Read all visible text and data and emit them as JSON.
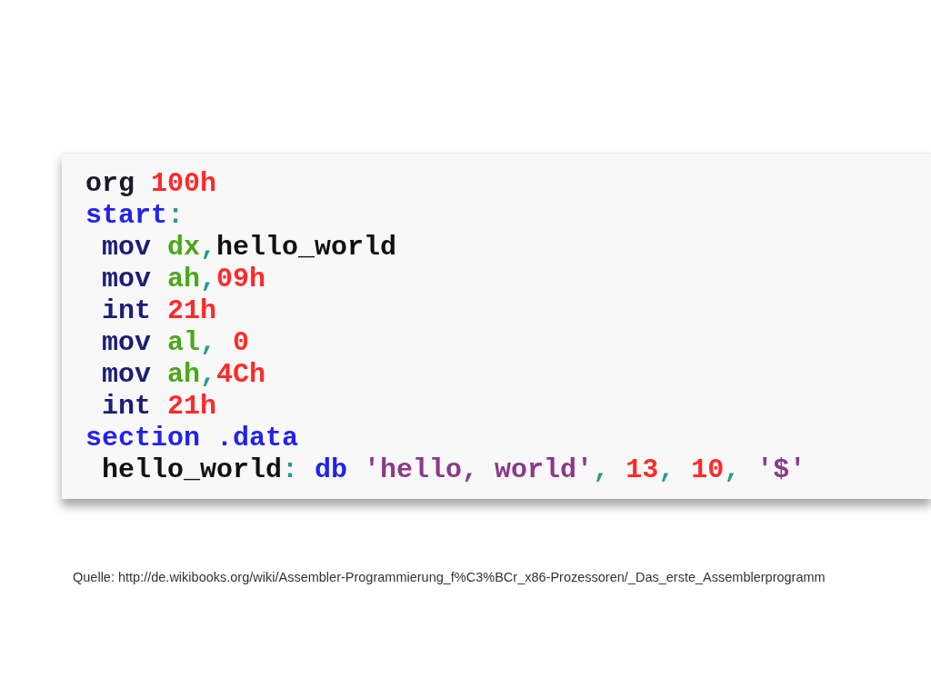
{
  "code_lines": [
    {
      "tokens": [
        {
          "text": "org ",
          "kind": "directive"
        },
        {
          "text": "100h",
          "kind": "number"
        }
      ]
    },
    {
      "tokens": [
        {
          "text": "start",
          "kind": "label"
        },
        {
          "text": ":",
          "kind": "punct"
        }
      ]
    },
    {
      "tokens": [
        {
          "text": " mov ",
          "kind": "instruction"
        },
        {
          "text": "dx",
          "kind": "register"
        },
        {
          "text": ",",
          "kind": "punct"
        },
        {
          "text": "hello_world",
          "kind": "plain"
        }
      ]
    },
    {
      "tokens": [
        {
          "text": " mov ",
          "kind": "instruction"
        },
        {
          "text": "ah",
          "kind": "register"
        },
        {
          "text": ",",
          "kind": "punct"
        },
        {
          "text": "09h",
          "kind": "number"
        }
      ]
    },
    {
      "tokens": [
        {
          "text": " int ",
          "kind": "instruction"
        },
        {
          "text": "21h",
          "kind": "number"
        }
      ]
    },
    {
      "tokens": [
        {
          "text": " mov ",
          "kind": "instruction"
        },
        {
          "text": "al",
          "kind": "register"
        },
        {
          "text": ", ",
          "kind": "punct"
        },
        {
          "text": "0",
          "kind": "number"
        }
      ]
    },
    {
      "tokens": [
        {
          "text": " mov ",
          "kind": "instruction"
        },
        {
          "text": "ah",
          "kind": "register"
        },
        {
          "text": ",",
          "kind": "punct"
        },
        {
          "text": "4Ch",
          "kind": "number"
        }
      ]
    },
    {
      "tokens": [
        {
          "text": " int ",
          "kind": "instruction"
        },
        {
          "text": "21h",
          "kind": "number"
        }
      ]
    },
    {
      "tokens": [
        {
          "text": "section .data",
          "kind": "label"
        }
      ]
    },
    {
      "tokens": [
        {
          "text": " hello_world",
          "kind": "plain"
        },
        {
          "text": ": ",
          "kind": "punct"
        },
        {
          "text": "db ",
          "kind": "label"
        },
        {
          "text": "'hello, world'",
          "kind": "string"
        },
        {
          "text": ", ",
          "kind": "punct"
        },
        {
          "text": "13",
          "kind": "number"
        },
        {
          "text": ", ",
          "kind": "punct"
        },
        {
          "text": "10",
          "kind": "number"
        },
        {
          "text": ", ",
          "kind": "punct"
        },
        {
          "text": "'$'",
          "kind": "string"
        }
      ]
    }
  ],
  "caption": "Quelle: http://de.wikibooks.org/wiki/Assembler-Programmierung_f%C3%BCr_x86-Prozessoren/_Das_erste_Assemblerprogramm"
}
